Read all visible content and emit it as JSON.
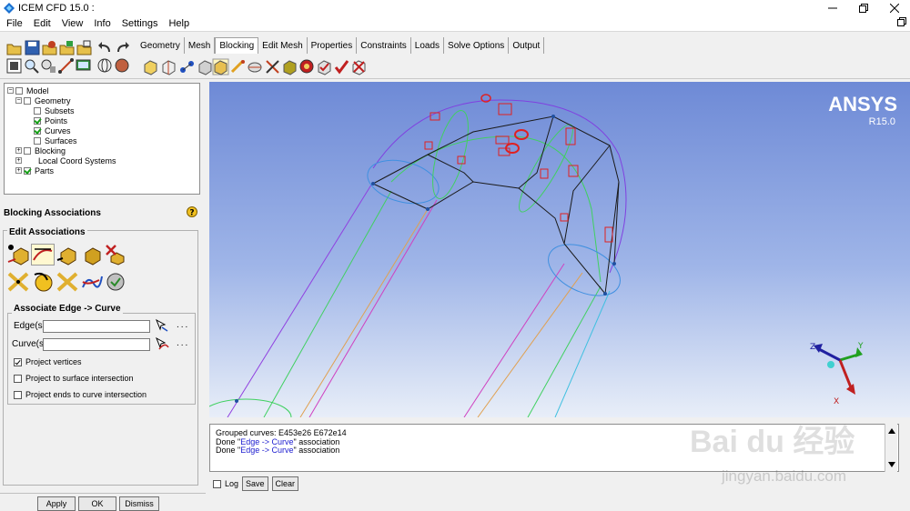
{
  "window": {
    "title": "ICEM CFD 15.0 :"
  },
  "menu": [
    "File",
    "Edit",
    "View",
    "Info",
    "Settings",
    "Help"
  ],
  "tabs": [
    "Geometry",
    "Mesh",
    "Blocking",
    "Edit Mesh",
    "Properties",
    "Constraints",
    "Loads",
    "Solve Options",
    "Output"
  ],
  "active_tab": "Blocking",
  "tree": [
    {
      "label": "Model",
      "level": 0,
      "expander": "−",
      "checked": false,
      "has_cb": true
    },
    {
      "label": "Geometry",
      "level": 1,
      "expander": "−",
      "checked": false,
      "has_cb": true
    },
    {
      "label": "Subsets",
      "level": 2,
      "expander": "",
      "checked": false,
      "has_cb": true
    },
    {
      "label": "Points",
      "level": 2,
      "expander": "",
      "checked": true,
      "has_cb": true
    },
    {
      "label": "Curves",
      "level": 2,
      "expander": "",
      "checked": true,
      "has_cb": true
    },
    {
      "label": "Surfaces",
      "level": 2,
      "expander": "",
      "checked": false,
      "has_cb": true
    },
    {
      "label": "Blocking",
      "level": 1,
      "expander": "+",
      "checked": false,
      "has_cb": true
    },
    {
      "label": "Local Coord Systems",
      "level": 1,
      "expander": "+",
      "checked": false,
      "has_cb": false
    },
    {
      "label": "Parts",
      "level": 1,
      "expander": "+",
      "checked": true,
      "has_cb": true
    }
  ],
  "panel": {
    "title": "Blocking Associations",
    "edit_group": "Edit Associations",
    "assoc_group": "Associate Edge -> Curve",
    "edges_label": "Edge(s)",
    "curves_label": "Curve(s)",
    "edges_value": "",
    "curves_value": "",
    "dots": "...",
    "project_vertices": "Project vertices",
    "project_surface": "Project to surface intersection",
    "project_ends": "Project ends to curve intersection"
  },
  "bottom_buttons": {
    "apply": "Apply",
    "ok": "OK",
    "dismiss": "Dismiss"
  },
  "viewport": {
    "logo": "ANSYS",
    "release": "R15.0",
    "axis_z": "Z",
    "axis_y": "Y",
    "axis_x": "X"
  },
  "messages": {
    "line1": "Grouped curves: E453e26 E672e14",
    "line2_pre": "Done \"",
    "line2_hl": "Edge -> Curve",
    "line2_post": "\" association",
    "line3_pre": "Done \"",
    "line3_hl": "Edge -> Curve",
    "line3_post": "\" association",
    "log_label": "Log",
    "save_label": "Save",
    "clear_label": "Clear"
  },
  "watermark": {
    "brand": "Bai du 经验",
    "url": "jingyan.baidu.com"
  },
  "colors": {
    "viewport_top": "#6e8ad6",
    "blocking_edge": "#1a1a1a",
    "curve_purple": "#8040e0",
    "curve_green": "#40d060"
  }
}
